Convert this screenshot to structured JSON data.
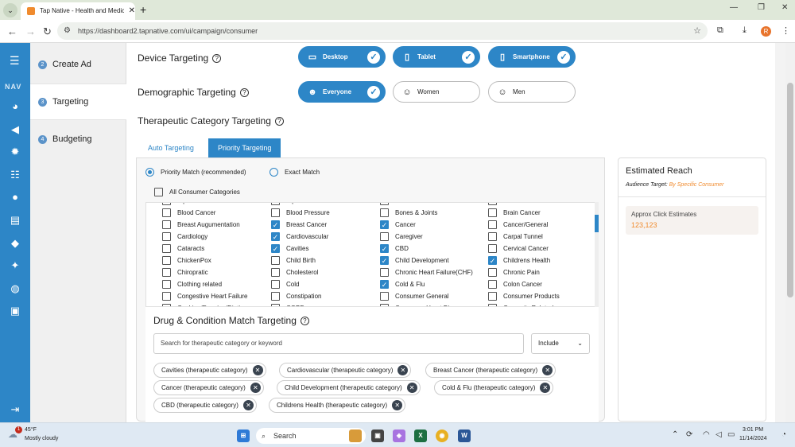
{
  "browser": {
    "tab_title": "Tap Native - Health and Medic",
    "url": "https://dashboard2.tapnative.com/ui/campaign/consumer",
    "profile_initial": "R"
  },
  "sidebar": {
    "nav_label": "NAV"
  },
  "steps": [
    {
      "num": "2",
      "label": "Create Ad"
    },
    {
      "num": "3",
      "label": "Targeting"
    },
    {
      "num": "4",
      "label": "Budgeting"
    }
  ],
  "device": {
    "title": "Device Targeting",
    "options": [
      {
        "label": "Desktop",
        "on": true
      },
      {
        "label": "Tablet",
        "on": true
      },
      {
        "label": "Smartphone",
        "on": true
      }
    ]
  },
  "demographic": {
    "title": "Demographic Targeting",
    "options": [
      {
        "label": "Everyone",
        "on": true
      },
      {
        "label": "Women",
        "on": false
      },
      {
        "label": "Men",
        "on": false
      }
    ]
  },
  "therapeutic": {
    "title": "Therapeutic Category Targeting",
    "tabs": [
      "Auto Targeting",
      "Priority Targeting"
    ],
    "match_options": [
      "Priority Match (recommended)",
      "Exact Match"
    ],
    "all_label": "All Consumer Categories",
    "columns": [
      [
        {
          "label": "Bipolar",
          "on": false
        },
        {
          "label": "Blood Cancer",
          "on": false
        },
        {
          "label": "Breast Augumentation",
          "on": false
        },
        {
          "label": "Cardiology",
          "on": false
        },
        {
          "label": "Cataracts",
          "on": false
        },
        {
          "label": "ChickenPox",
          "on": false
        },
        {
          "label": "Chiropratic",
          "on": false
        },
        {
          "label": "Clothing related",
          "on": false
        },
        {
          "label": "Congestive Heart Failure",
          "on": false
        },
        {
          "label": "Cooking/Dancing/Dieting",
          "on": false
        }
      ],
      [
        {
          "label": "Bipolar Disorder",
          "on": false
        },
        {
          "label": "Blood Pressure",
          "on": false
        },
        {
          "label": "Breast Cancer",
          "on": true
        },
        {
          "label": "Cardiovascular",
          "on": true
        },
        {
          "label": "Cavities",
          "on": true
        },
        {
          "label": "Child Birth",
          "on": false
        },
        {
          "label": "Cholesterol",
          "on": false
        },
        {
          "label": "Cold",
          "on": false
        },
        {
          "label": "Constipation",
          "on": false
        },
        {
          "label": "COPD",
          "on": false
        }
      ],
      [
        {
          "label": "Birth Control",
          "on": false
        },
        {
          "label": "Bones & Joints",
          "on": false
        },
        {
          "label": "Cancer",
          "on": true
        },
        {
          "label": "Caregiver",
          "on": false
        },
        {
          "label": "CBD",
          "on": true
        },
        {
          "label": "Child Development",
          "on": true
        },
        {
          "label": "Chronic Heart Failure(CHF)",
          "on": false
        },
        {
          "label": "Cold & Flu",
          "on": true
        },
        {
          "label": "Consumer General",
          "on": false
        },
        {
          "label": "Consumer Heart Disease",
          "on": false
        }
      ],
      [
        {
          "label": "Blood",
          "on": false
        },
        {
          "label": "Brain Cancer",
          "on": false
        },
        {
          "label": "Cancer/General",
          "on": false
        },
        {
          "label": "Carpal Tunnel",
          "on": false
        },
        {
          "label": "Cervical Cancer",
          "on": false
        },
        {
          "label": "Childrens Health",
          "on": true
        },
        {
          "label": "Chronic Pain",
          "on": false
        },
        {
          "label": "Colon Cancer",
          "on": false
        },
        {
          "label": "Consumer Products",
          "on": false
        },
        {
          "label": "Cosmetic Related",
          "on": false
        }
      ]
    ]
  },
  "drug": {
    "title": "Drug & Condition Match Targeting",
    "search_placeholder": "Search for therapeutic category or keyword",
    "select_value": "Include",
    "chips": [
      "Cavities (therapeutic category)",
      "Cardiovascular (therapeutic category)",
      "Breast Cancer (therapeutic category)",
      "Cancer (therapeutic category)",
      "Child Development (therapeutic category)",
      "Cold & Flu (therapeutic category)",
      "CBD (therapeutic category)",
      "Childrens Health (therapeutic category)"
    ]
  },
  "reach": {
    "title": "Estimated Reach",
    "audience_label": "Audience Target:",
    "audience_value": "By Specific Consumer",
    "click_label": "Approx Click Estimates",
    "click_value": "123,123"
  },
  "taskbar": {
    "temp": "45°F",
    "weather": "Mostly cloudy",
    "badge": "1",
    "search": "Search",
    "time": "3:01 PM",
    "date": "11/14/2024"
  },
  "colors": {
    "primary": "#2d86c7",
    "accent": "#f08b2e"
  }
}
